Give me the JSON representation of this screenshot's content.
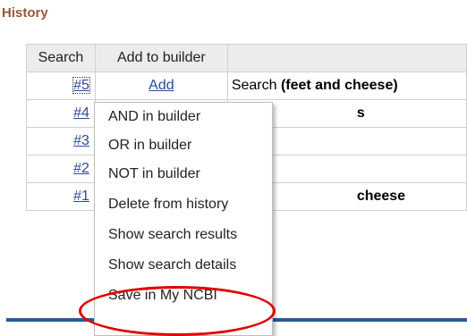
{
  "panel": {
    "title": "History"
  },
  "table": {
    "headers": [
      "Search",
      "Add to builder",
      ""
    ],
    "rows": [
      {
        "num": "#5",
        "add": "Add",
        "query_prefix": "Search ",
        "query_bold": "(feet and cheese)"
      },
      {
        "num": "#4",
        "add": "",
        "query_prefix": "",
        "query_bold": "s"
      },
      {
        "num": "#3",
        "add": "",
        "query_prefix": "",
        "query_bold": ""
      },
      {
        "num": "#2",
        "add": "",
        "query_prefix": "",
        "query_bold": ""
      },
      {
        "num": "#1",
        "add": "",
        "query_prefix": "",
        "query_bold": "cheese"
      }
    ]
  },
  "context_menu": {
    "items": [
      "AND in builder",
      "OR in builder",
      "NOT in builder",
      "Delete from history",
      "Show search results",
      "Show search details",
      "Save in My NCBI"
    ]
  },
  "colors": {
    "title": "#985735",
    "link": "#2a4a9b",
    "highlight": "#e20000",
    "rule": "#2b5a96"
  }
}
